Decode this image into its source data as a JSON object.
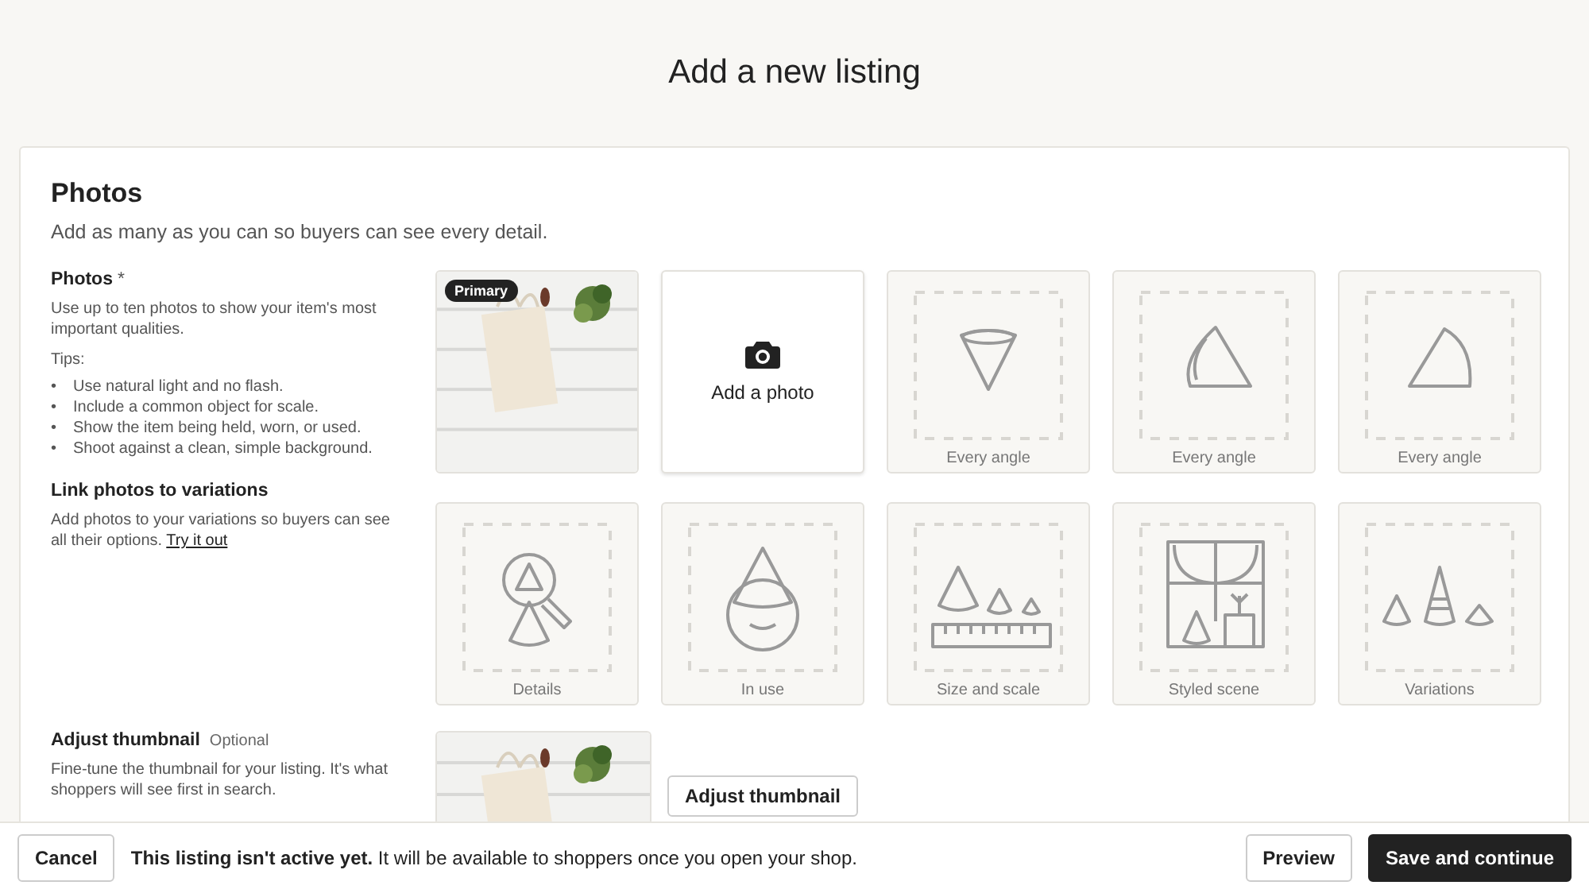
{
  "page_title": "Add a new listing",
  "section": {
    "title": "Photos",
    "subtitle": "Add as many as you can so buyers can see every detail."
  },
  "photos_help": {
    "label": "Photos",
    "required_mark": "*",
    "description": "Use up to ten photos to show your item's most important qualities.",
    "tips_label": "Tips:",
    "tip_marker": "•",
    "tips": [
      "Use natural light and no flash.",
      "Include a common object for scale.",
      "Show the item being held, worn, or used.",
      "Shoot against a clean, simple background."
    ]
  },
  "variations_help": {
    "label": "Link photos to variations",
    "description": "Add photos to your variations so buyers can see all their options.",
    "link": "Try it out"
  },
  "slots": [
    {
      "badge": "Primary"
    },
    {
      "kind": "add",
      "label": "Add a photo"
    },
    {
      "kind": "placeholder",
      "label": "Every angle"
    },
    {
      "kind": "placeholder",
      "label": "Every angle"
    },
    {
      "kind": "placeholder",
      "label": "Every angle"
    },
    {
      "kind": "placeholder",
      "label": "Details"
    },
    {
      "kind": "placeholder",
      "label": "In use"
    },
    {
      "kind": "placeholder",
      "label": "Size and scale"
    },
    {
      "kind": "placeholder",
      "label": "Styled scene"
    },
    {
      "kind": "placeholder",
      "label": "Variations"
    }
  ],
  "thumbnail": {
    "label": "Adjust thumbnail",
    "optional": "Optional",
    "description": "Fine-tune the thumbnail for your listing. It's what shoppers will see first in search.",
    "button": "Adjust thumbnail"
  },
  "footer": {
    "cancel": "Cancel",
    "message": "**This listing isn't active yet.** It will be available to shoppers once you open your shop.",
    "preview": "Preview",
    "save": "Save and continue"
  }
}
